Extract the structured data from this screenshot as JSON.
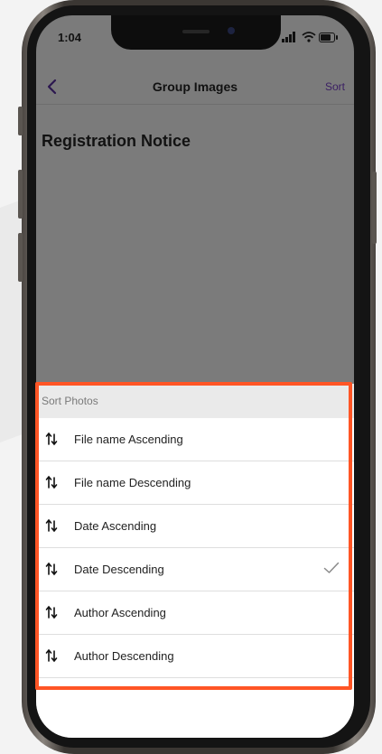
{
  "status_bar": {
    "time": "1:04"
  },
  "nav": {
    "title": "Group Images",
    "sort_label": "Sort"
  },
  "page": {
    "title": "Registration Notice"
  },
  "sort_sheet": {
    "header": "Sort Photos",
    "options": [
      {
        "label": "File name Ascending",
        "selected": false
      },
      {
        "label": "File name Descending",
        "selected": false
      },
      {
        "label": "Date Ascending",
        "selected": false
      },
      {
        "label": "Date Descending",
        "selected": true
      },
      {
        "label": "Author Ascending",
        "selected": false
      },
      {
        "label": "Author Descending",
        "selected": false
      }
    ]
  },
  "colors": {
    "highlight": "#ff5525",
    "accent": "#3a1e63",
    "overlay": "#7b7b7b"
  }
}
